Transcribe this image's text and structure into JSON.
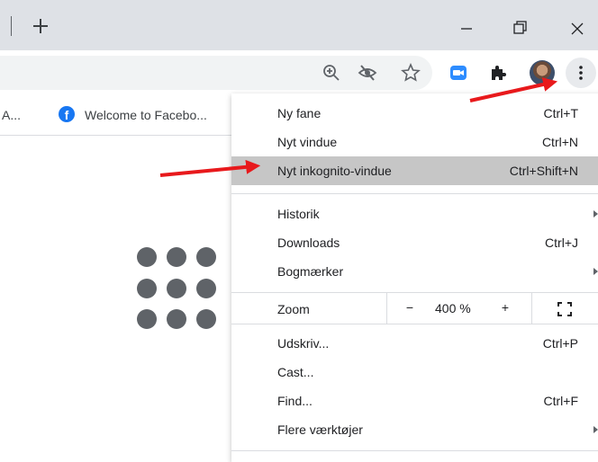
{
  "titlebar": {
    "new_tab_icon": "plus-icon",
    "window_controls": [
      "minimize-icon",
      "restore-icon",
      "close-icon"
    ]
  },
  "toolbar": {
    "icons": [
      "zoom-icon",
      "eye-off-icon",
      "star-icon",
      "zoom-extension-icon",
      "puzzle-icon",
      "avatar",
      "more-vert-icon"
    ]
  },
  "bookmarks": {
    "item_a": "A...",
    "item_facebook": "Welcome to Facebo..."
  },
  "menu": {
    "items_top": [
      {
        "label": "Ny fane",
        "shortcut": "Ctrl+T"
      },
      {
        "label": "Nyt vindue",
        "shortcut": "Ctrl+N"
      },
      {
        "label": "Nyt inkognito-vindue",
        "shortcut": "Ctrl+Shift+N"
      }
    ],
    "items_mid": [
      {
        "label": "Historik",
        "shortcut": ""
      },
      {
        "label": "Downloads",
        "shortcut": "Ctrl+J"
      },
      {
        "label": "Bogmærker",
        "shortcut": ""
      }
    ],
    "zoom": {
      "label": "Zoom",
      "minus": "−",
      "value": "400 %",
      "plus": "+"
    },
    "items_bottom": [
      {
        "label": "Udskriv...",
        "shortcut": "Ctrl+P"
      },
      {
        "label": "Cast...",
        "shortcut": ""
      },
      {
        "label": "Find...",
        "shortcut": "Ctrl+F"
      },
      {
        "label": "Flere værktøjer",
        "shortcut": ""
      }
    ]
  },
  "colors": {
    "annotation_arrow": "#e8191c",
    "highlight": "#c6c6c6",
    "facebook": "#1877f2",
    "zoom_blue": "#2d8cff"
  }
}
